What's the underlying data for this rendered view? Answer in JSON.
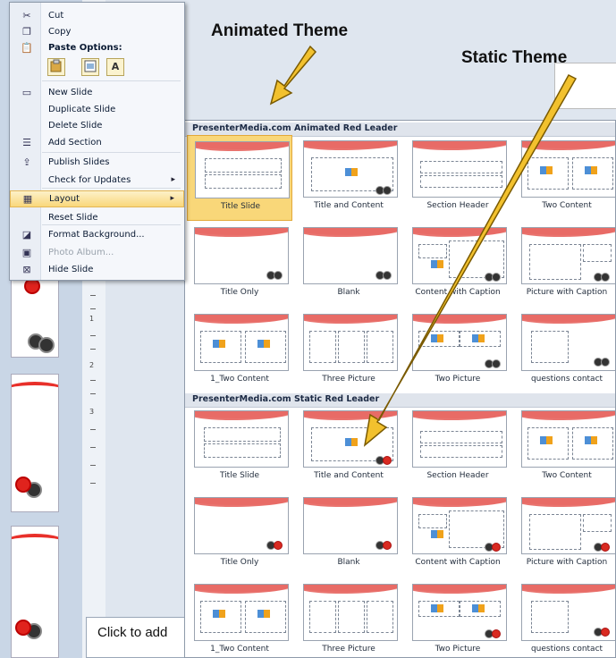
{
  "annotations": {
    "animated_theme": "Animated Theme",
    "static_theme": "Static Theme"
  },
  "context_menu": {
    "items": [
      {
        "label": "Cut",
        "icon": "scissors-icon"
      },
      {
        "label": "Copy",
        "icon": "copy-icon"
      },
      {
        "label": "Paste Options:",
        "icon": "paste-icon"
      },
      {
        "label": "New Slide",
        "icon": "new-slide-icon"
      },
      {
        "label": "Duplicate Slide",
        "icon": ""
      },
      {
        "label": "Delete Slide",
        "icon": ""
      },
      {
        "label": "Add Section",
        "icon": "section-icon"
      },
      {
        "label": "Publish Slides",
        "icon": "publish-icon"
      },
      {
        "label": "Check for Updates",
        "icon": ""
      },
      {
        "label": "Layout",
        "icon": "layout-icon"
      },
      {
        "label": "Reset Slide",
        "icon": ""
      },
      {
        "label": "Format Background...",
        "icon": "format-background-icon"
      },
      {
        "label": "Photo Album...",
        "icon": "photo-album-icon"
      },
      {
        "label": "Hide Slide",
        "icon": "hide-slide-icon"
      }
    ],
    "paste_buttons": [
      "",
      "",
      "A"
    ]
  },
  "gallery": {
    "sections": [
      {
        "title": "PresenterMedia.com Animated Red Leader"
      },
      {
        "title": "PresenterMedia.com Static Red Leader"
      }
    ],
    "layouts": [
      "Title Slide",
      "Title and Content",
      "Section Header",
      "Two Content",
      "Title Only",
      "Blank",
      "Content with Caption",
      "Picture with Caption",
      "1_Two Content",
      "Three Picture",
      "Two Picture",
      "questions contact"
    ],
    "selected": "Title Slide"
  },
  "notes": {
    "placeholder": "Click to add"
  },
  "ruler": {
    "numbers": [
      "1",
      "2",
      "3"
    ]
  },
  "colors": {
    "accent_red": "#e0231d",
    "highlight": "#f9d779",
    "arrow_fill": "#f2c12e"
  }
}
